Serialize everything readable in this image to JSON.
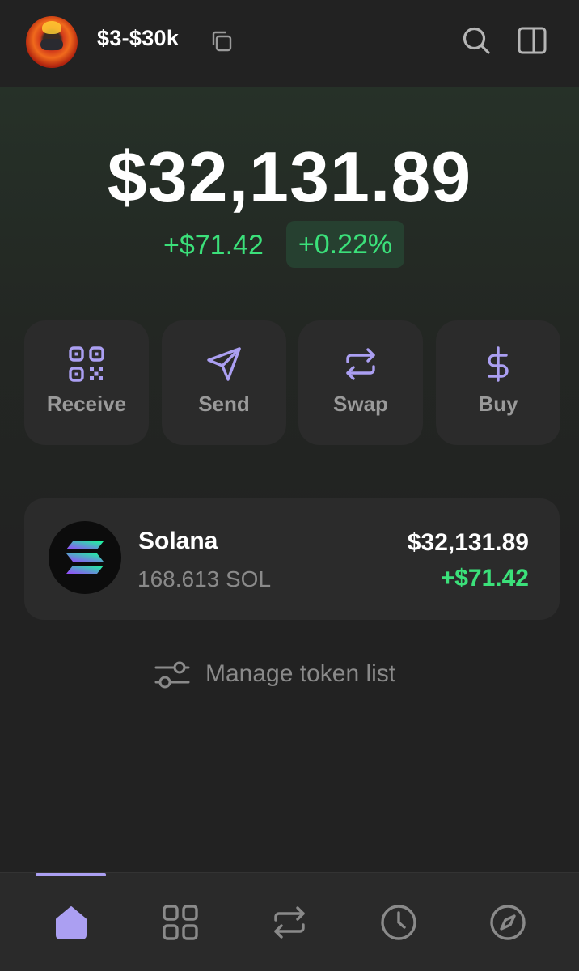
{
  "header": {
    "account_name": "$3-$30k",
    "icons": [
      "avatar",
      "copy-icon",
      "search-icon",
      "sidebar-panel-icon"
    ]
  },
  "portfolio": {
    "balance": "$32,131.89",
    "change_amount": "+$71.42",
    "change_percent": "+0.22%"
  },
  "actions": [
    {
      "label": "Receive",
      "icon": "qr-code-icon"
    },
    {
      "label": "Send",
      "icon": "send-icon"
    },
    {
      "label": "Swap",
      "icon": "swap-icon"
    },
    {
      "label": "Buy",
      "icon": "dollar-icon"
    }
  ],
  "tokens": [
    {
      "name": "Solana",
      "quantity": "168.613 SOL",
      "value": "$32,131.89",
      "change": "+$71.42",
      "icon": "solana-logo"
    }
  ],
  "manage_tokens": {
    "label": "Manage token list",
    "icon": "sliders-icon"
  },
  "bottom_nav": {
    "items": [
      "home-icon",
      "collectibles-grid-icon",
      "swap-icon",
      "history-clock-icon",
      "explore-compass-icon"
    ],
    "active": "home-icon"
  },
  "colors": {
    "background": "#222222",
    "accent_purple": "#ab9ff2",
    "positive_green": "#3be07a",
    "card": "#2b2b2b",
    "muted_text": "#8a8a8a"
  }
}
